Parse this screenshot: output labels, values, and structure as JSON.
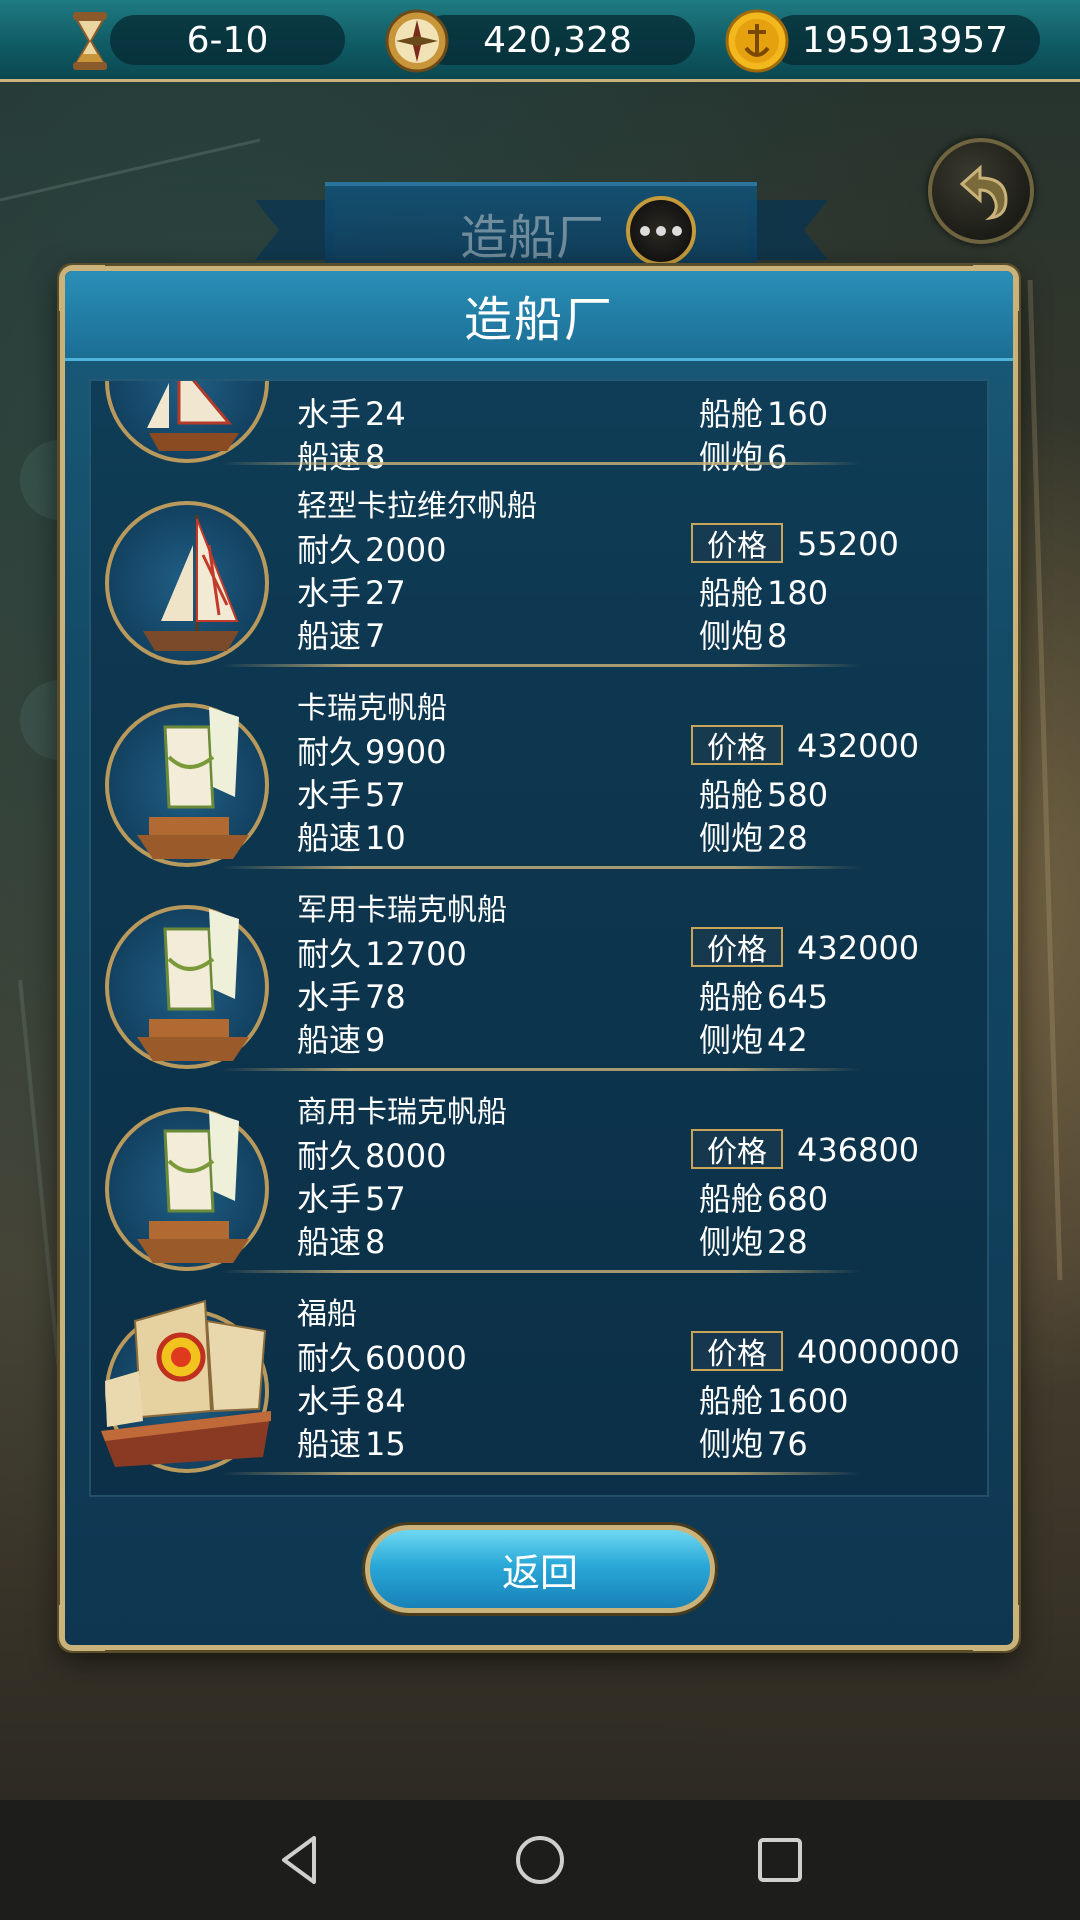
{
  "top_bar": {
    "turn": "6-10",
    "compass_value": "420,328",
    "gold": "195913957"
  },
  "background_panel": {
    "title": "造船厂"
  },
  "dialog": {
    "title": "造船厂",
    "return_label": "返回",
    "price_label": "价格",
    "stat_labels": {
      "durability": "耐久",
      "crew": "水手",
      "speed": "船速",
      "cabin": "船舱",
      "cannon": "侧炮"
    },
    "ships": [
      {
        "name": "",
        "durability": "",
        "price": "",
        "crew": "24",
        "cabin": "160",
        "speed": "8",
        "cannon": "6"
      },
      {
        "name": "轻型卡拉维尔帆船",
        "durability": "2000",
        "price": "55200",
        "crew": "27",
        "cabin": "180",
        "speed": "7",
        "cannon": "8"
      },
      {
        "name": "卡瑞克帆船",
        "durability": "9900",
        "price": "432000",
        "crew": "57",
        "cabin": "580",
        "speed": "10",
        "cannon": "28"
      },
      {
        "name": "军用卡瑞克帆船",
        "durability": "12700",
        "price": "432000",
        "crew": "78",
        "cabin": "645",
        "speed": "9",
        "cannon": "42"
      },
      {
        "name": "商用卡瑞克帆船",
        "durability": "8000",
        "price": "436800",
        "crew": "57",
        "cabin": "680",
        "speed": "8",
        "cannon": "28"
      },
      {
        "name": "福船",
        "durability": "60000",
        "price": "40000000",
        "crew": "84",
        "cabin": "1600",
        "speed": "15",
        "cannon": "76"
      }
    ]
  },
  "colors": {
    "gold_border": "#c9b37a",
    "dialog_blue": "#134a66",
    "button_blue": "#2aa8d8"
  },
  "icons": [
    "hourglass-icon",
    "compass-icon",
    "gold-coin-icon",
    "back-arrow-icon",
    "chat-icon",
    "nav-back-icon",
    "nav-home-icon",
    "nav-recents-icon"
  ]
}
